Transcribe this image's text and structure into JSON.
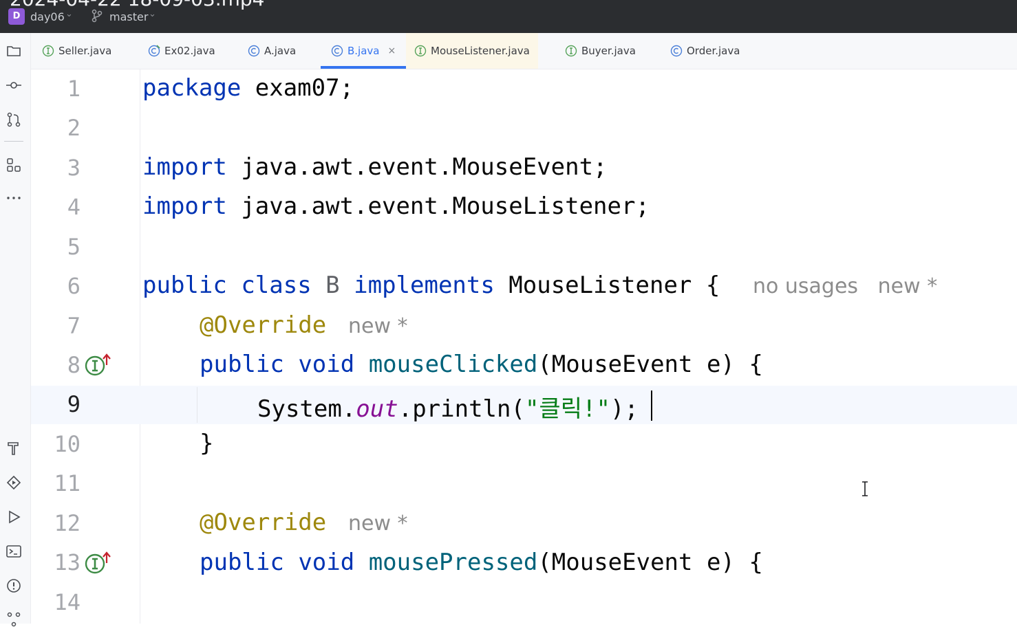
{
  "titlebar": {
    "cut_title": "2024-04-22 18-09-03.mp4",
    "project_badge": "D",
    "project_name": "day06",
    "branch_name": "master"
  },
  "sidebar": {
    "top_icons": [
      "project-folder-icon",
      "commit-icon",
      "pull-request-icon",
      "structure-icon",
      "more-icon"
    ],
    "bottom_icons": [
      "build-hammer-icon",
      "services-icon",
      "run-icon",
      "terminal-icon",
      "problems-icon",
      "git-icon"
    ]
  },
  "tabs": [
    {
      "label": "Seller.java",
      "kind": "interface"
    },
    {
      "label": "Ex02.java",
      "kind": "class-main"
    },
    {
      "label": "A.java",
      "kind": "class"
    },
    {
      "label": "B.java",
      "kind": "class",
      "active": true,
      "close": "×"
    },
    {
      "label": "MouseListener.java",
      "kind": "interface"
    },
    {
      "label": "Buyer.java",
      "kind": "interface"
    },
    {
      "label": "Order.java",
      "kind": "class"
    }
  ],
  "editor": {
    "line_numbers": [
      "1",
      "2",
      "3",
      "4",
      "5",
      "6",
      "7",
      "8",
      "9",
      "10",
      "11",
      "12",
      "13",
      "14"
    ],
    "current_line": "9",
    "lines": {
      "l1": {
        "kw": "package",
        "rest": " exam07;"
      },
      "l3": {
        "kw": "import",
        "rest": " java.awt.event.MouseEvent;"
      },
      "l4": {
        "kw": "import",
        "rest": " java.awt.event.MouseListener;"
      },
      "l6": {
        "kw1": "public",
        "kw2": "class",
        "name": "B",
        "kw3": "implements",
        "rest": " MouseListener {"
      },
      "l6_hint": "no usages   new *",
      "l7": {
        "ann": "@Override"
      },
      "l7_hint": "new *",
      "l8": {
        "kw1": "public",
        "kw2": "void",
        "fn": "mouseClicked",
        "rest": "(MouseEvent e) {"
      },
      "l9": {
        "pre": "System.",
        "fld": "out",
        "mid": ".println(",
        "str": "\"클릭!\"",
        "post": ");"
      },
      "l10": {
        "rest": "}"
      },
      "l12": {
        "ann": "@Override"
      },
      "l12_hint": "new *",
      "l13": {
        "kw1": "public",
        "kw2": "void",
        "fn": "mousePressed",
        "rest": "(MouseEvent e) {"
      }
    }
  },
  "colors": {
    "keyword": "#0033b3",
    "annotation": "#9e880d",
    "method": "#00627a",
    "field": "#871094",
    "string": "#067d17",
    "active_tab": "#3574f0"
  }
}
